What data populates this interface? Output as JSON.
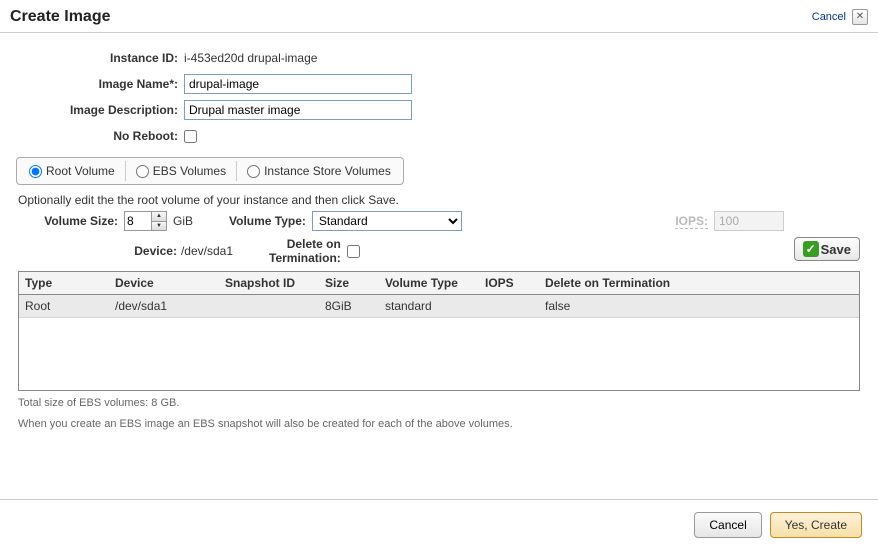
{
  "header": {
    "title": "Create Image",
    "cancel": "Cancel",
    "close_symbol": "✕"
  },
  "form": {
    "instance_id_label": "Instance ID:",
    "instance_id_value": "i-453ed20d drupal-image",
    "image_name_label": "Image Name*:",
    "image_name_value": "drupal-image",
    "image_desc_label": "Image Description:",
    "image_desc_value": "Drupal master image",
    "no_reboot_label": "No Reboot:"
  },
  "tabs": {
    "root": "Root Volume",
    "ebs": "EBS Volumes",
    "instance_store": "Instance Store Volumes"
  },
  "panel": {
    "hint": "Optionally edit the the root volume of your instance and then click Save.",
    "volume_size_label": "Volume Size:",
    "volume_size_value": "8",
    "volume_size_unit": "GiB",
    "volume_type_label": "Volume Type:",
    "volume_type_value": "Standard",
    "iops_label": "IOPS:",
    "iops_value": "100",
    "device_label": "Device:",
    "device_value": "/dev/sda1",
    "delete_term_label": "Delete on\nTermination:",
    "save_label": "Save"
  },
  "table": {
    "headers": {
      "type": "Type",
      "device": "Device",
      "snapshot_id": "Snapshot ID",
      "size": "Size",
      "volume_type": "Volume Type",
      "iops": "IOPS",
      "delete_term": "Delete on Termination"
    },
    "rows": [
      {
        "type": "Root",
        "device": "/dev/sda1",
        "snapshot_id": "",
        "size": "8GiB",
        "volume_type": "standard",
        "iops": "",
        "delete_term": "false"
      }
    ]
  },
  "footnotes": {
    "line1": "Total size of EBS volumes: 8 GB.",
    "line2": "When you create an EBS image an EBS snapshot will also be created for each of the above volumes."
  },
  "footer": {
    "cancel": "Cancel",
    "yes_create": "Yes, Create"
  }
}
